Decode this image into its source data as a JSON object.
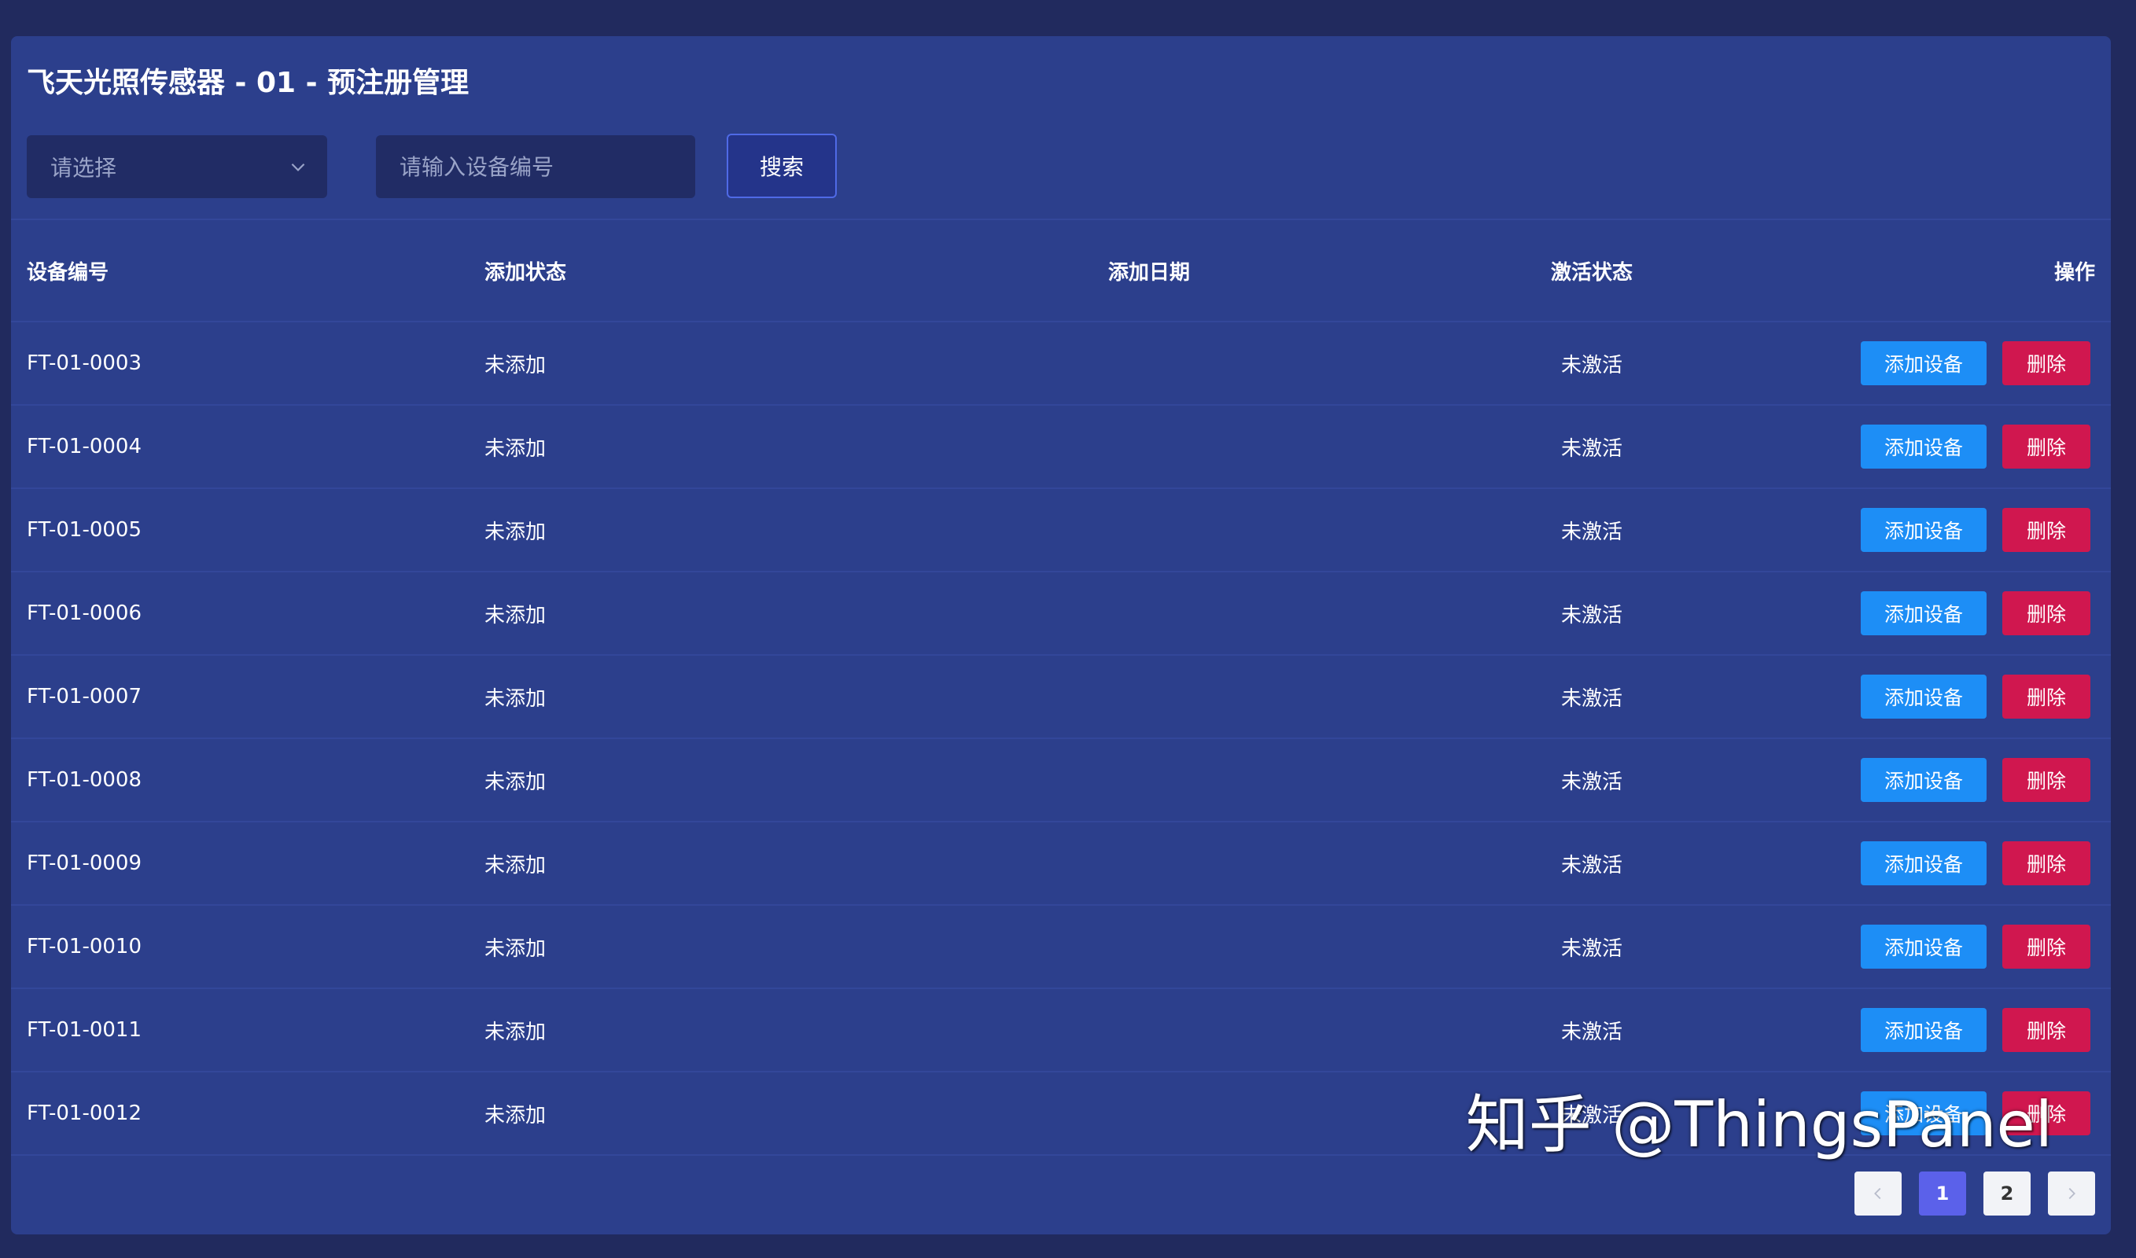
{
  "page": {
    "title": "飞天光照传感器 - 01 - 预注册管理"
  },
  "filters": {
    "select_placeholder": "请选择",
    "input_placeholder": "请输入设备编号",
    "search_label": "搜索"
  },
  "table": {
    "headers": {
      "device_id": "设备编号",
      "add_status": "添加状态",
      "add_date": "添加日期",
      "activation_status": "激活状态",
      "actions": "操作"
    },
    "rows": [
      {
        "device_id": "FT-01-0003",
        "add_status": "未添加",
        "add_date": "",
        "activation_status": "未激活"
      },
      {
        "device_id": "FT-01-0004",
        "add_status": "未添加",
        "add_date": "",
        "activation_status": "未激活"
      },
      {
        "device_id": "FT-01-0005",
        "add_status": "未添加",
        "add_date": "",
        "activation_status": "未激活"
      },
      {
        "device_id": "FT-01-0006",
        "add_status": "未添加",
        "add_date": "",
        "activation_status": "未激活"
      },
      {
        "device_id": "FT-01-0007",
        "add_status": "未添加",
        "add_date": "",
        "activation_status": "未激活"
      },
      {
        "device_id": "FT-01-0008",
        "add_status": "未添加",
        "add_date": "",
        "activation_status": "未激活"
      },
      {
        "device_id": "FT-01-0009",
        "add_status": "未添加",
        "add_date": "",
        "activation_status": "未激活"
      },
      {
        "device_id": "FT-01-0010",
        "add_status": "未添加",
        "add_date": "",
        "activation_status": "未激活"
      },
      {
        "device_id": "FT-01-0011",
        "add_status": "未添加",
        "add_date": "",
        "activation_status": "未激活"
      },
      {
        "device_id": "FT-01-0012",
        "add_status": "未添加",
        "add_date": "",
        "activation_status": "未激活"
      }
    ],
    "add_button_label": "添加设备",
    "delete_button_label": "删除"
  },
  "pagination": {
    "pages": [
      "1",
      "2"
    ],
    "current": "1"
  },
  "watermark": "知乎 @ThingsPanel",
  "icons": {
    "select_arrow": "chevron-down-icon",
    "prev": "chevron-left-icon",
    "next": "chevron-right-icon"
  },
  "colors": {
    "background": "#212a5e",
    "panel": "#2c3f8c",
    "add_button": "#1d8ef6",
    "delete_button": "#d0174f",
    "active_page": "#5b61ea"
  }
}
